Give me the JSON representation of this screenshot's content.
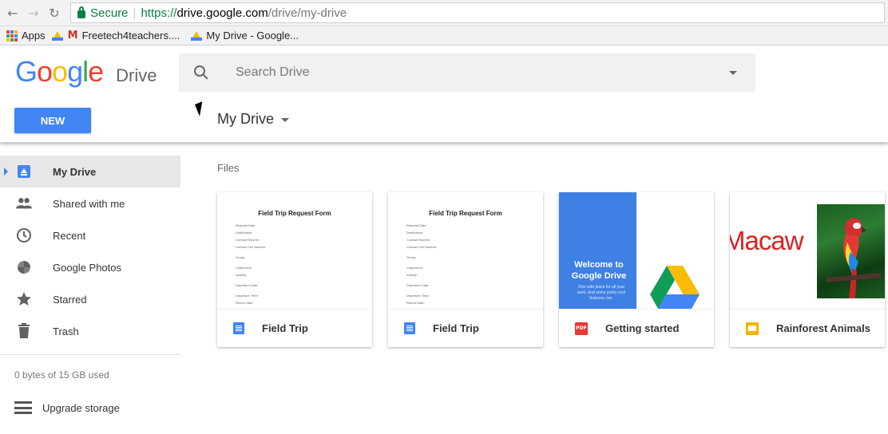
{
  "browser": {
    "back": "←",
    "forward": "→",
    "reload": "↻",
    "secure_label": "Secure",
    "url_scheme": "https://",
    "url_host": "drive.google.com",
    "url_path": "/drive/my-drive"
  },
  "bookmarks": [
    {
      "label": "Apps"
    },
    {
      "label": ""
    },
    {
      "label": "Freetech4teachers...."
    },
    {
      "label": "My Drive - Google..."
    }
  ],
  "header": {
    "logo_text": "Google",
    "product": "Drive",
    "search_placeholder": "Search Drive",
    "new_button": "NEW",
    "title": "My Drive"
  },
  "sidebar": {
    "items": [
      {
        "label": "My Drive",
        "icon": "drive-icon",
        "active": true
      },
      {
        "label": "Shared with me",
        "icon": "people-icon"
      },
      {
        "label": "Recent",
        "icon": "clock-icon"
      },
      {
        "label": "Google Photos",
        "icon": "pinwheel-icon"
      },
      {
        "label": "Starred",
        "icon": "star-icon"
      },
      {
        "label": "Trash",
        "icon": "trash-icon"
      }
    ],
    "quota": "0 bytes of 15 GB used",
    "upgrade": "Upgrade storage"
  },
  "content": {
    "section_label": "Files",
    "files": [
      {
        "name": "Field Trip",
        "type": "doc",
        "thumb_title": "Field Trip Request Form",
        "thumb_lines": [
          "Request Date:",
          "Destination:",
          "Contact/Teacher:",
          "Contact Cell Number:",
          "Group:",
          "Chaperone:",
          "Activity:",
          "Departure Date:",
          "Departure Time:",
          "Return Date:",
          "Return Time:",
          "Total Students:",
          "Time Arrival:"
        ]
      },
      {
        "name": "Field Trip",
        "type": "doc",
        "thumb_title": "Field Trip Request Form",
        "thumb_lines": [
          "Request Date:",
          "Destination:",
          "Contact/Teacher:",
          "Contact Cell Number:",
          "Group:",
          "Chaperone:",
          "Activity:",
          "Departure Date:",
          "Departure Time:",
          "Return Date:",
          "Return Time:",
          "Total Students:",
          "Time Arrival:"
        ]
      },
      {
        "name": "Getting started",
        "type": "pdf",
        "thumb_title": "Welcome to Google Drive",
        "thumb_sub": "One safe place for all your work. And some pretty cool features, too."
      },
      {
        "name": "Rainforest Animals",
        "type": "slides",
        "thumb_title": "Macaw"
      }
    ]
  },
  "colors": {
    "accent": "#4285f4",
    "secure": "#0b8043",
    "active_bg": "#e7e7e7"
  }
}
